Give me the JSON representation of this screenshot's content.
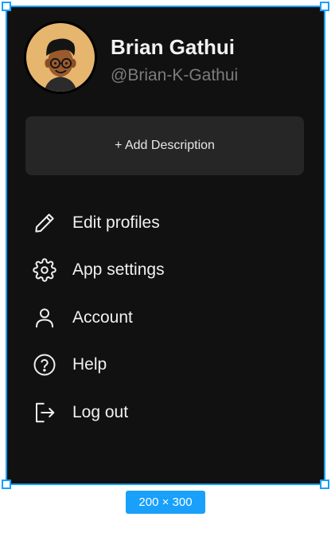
{
  "profile": {
    "name": "Brian Gathui",
    "handle": "@Brian-K-Gathui",
    "avatar_icon": "avatar-cartoon-icon"
  },
  "add_description": {
    "label": "+ Add Description"
  },
  "menu": {
    "items": [
      {
        "label": "Edit profiles",
        "icon": "pencil-icon"
      },
      {
        "label": "App settings",
        "icon": "gear-icon"
      },
      {
        "label": "Account",
        "icon": "user-icon"
      },
      {
        "label": "Help",
        "icon": "help-circle-icon"
      },
      {
        "label": "Log out",
        "icon": "logout-icon"
      }
    ]
  },
  "canvas": {
    "size_badge": "200 × 300"
  },
  "colors": {
    "background": "#111111",
    "card": "#262626",
    "handle_text": "#7c7c7c",
    "selection": "#18a0fb",
    "avatar_bg": "#e6b56e"
  }
}
